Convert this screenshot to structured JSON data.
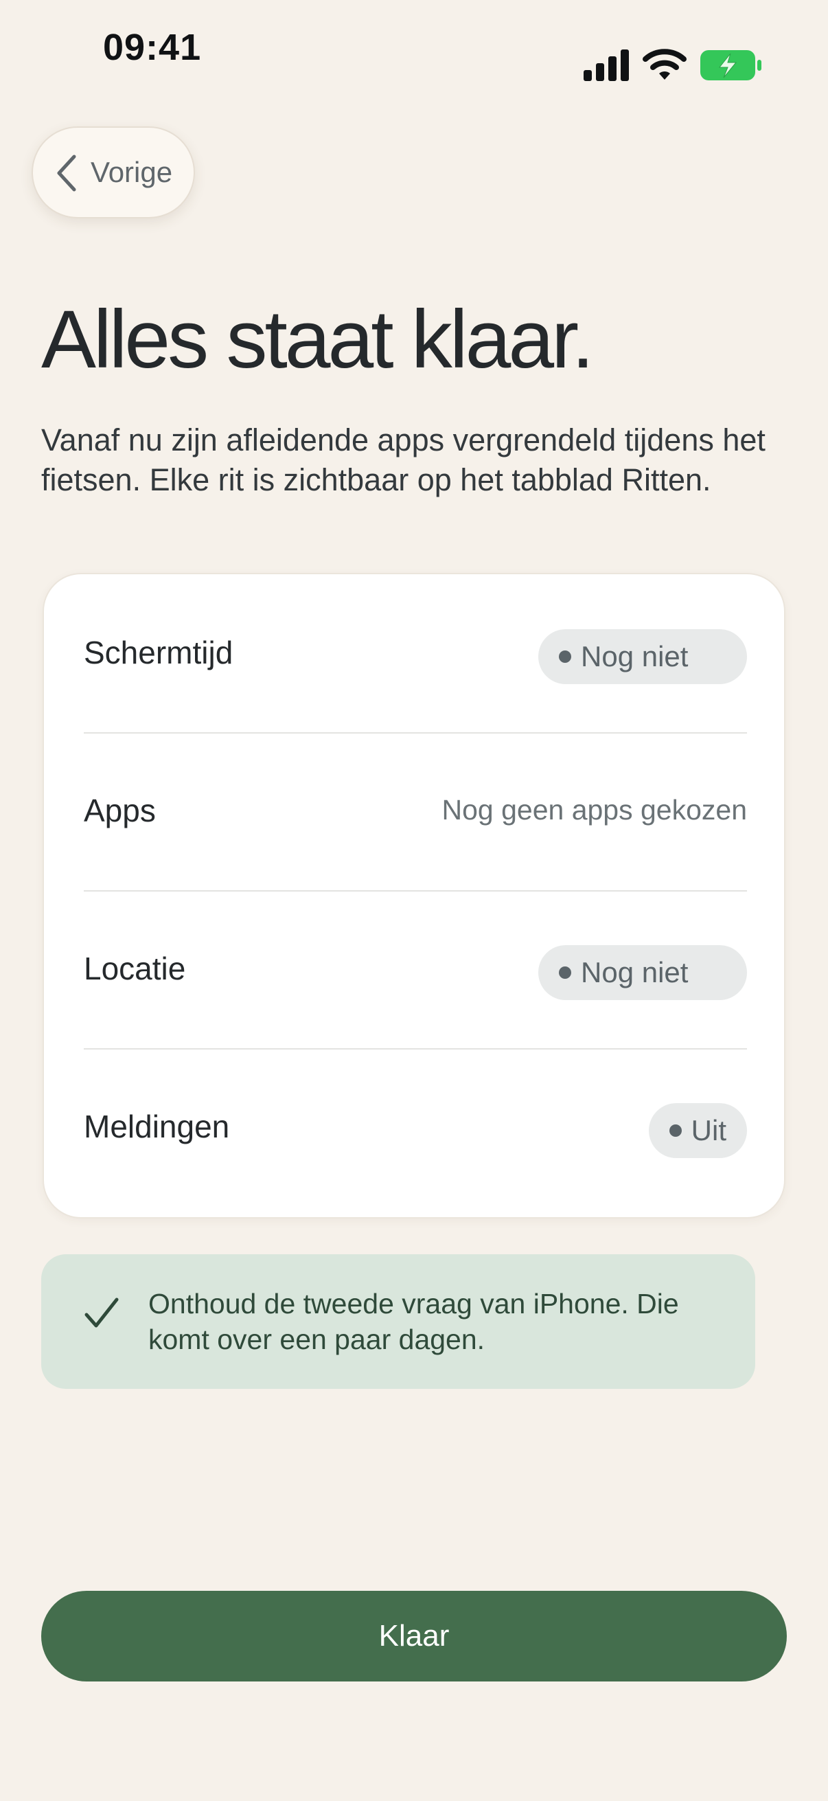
{
  "status_bar": {
    "time": "09:41",
    "icons": [
      "cellular-signal-icon",
      "wifi-icon",
      "battery-charging-icon"
    ],
    "battery_color": "#34c759"
  },
  "nav": {
    "back_label": "Vorige",
    "back_icon": "chevron-left-icon"
  },
  "header": {
    "title": "Alles staat klaar.",
    "intro": "Vanaf nu zijn afleidende apps vergrendeld tijdens het fietsen. Elke rit is zichtbaar op het tabblad Ritten."
  },
  "status_card": {
    "rows": [
      {
        "label": "Schermtijd",
        "value": "Nog niet",
        "style": "pill"
      },
      {
        "label": "Apps",
        "value": "Nog geen apps gekozen",
        "style": "text"
      },
      {
        "label": "Locatie",
        "value": "Nog niet",
        "style": "pill"
      },
      {
        "label": "Meldingen",
        "value": "Uit",
        "style": "pill"
      }
    ]
  },
  "info": {
    "icon": "checkmark-icon",
    "text": "Onthoud de tweede vraag van iPhone. Die komt over een paar dagen."
  },
  "footer": {
    "done_label": "Klaar"
  },
  "colors": {
    "background": "#f6f1ea",
    "accent_green": "#446e4d",
    "info_background": "#d9e6dc",
    "pill_background": "#e8eaea"
  }
}
